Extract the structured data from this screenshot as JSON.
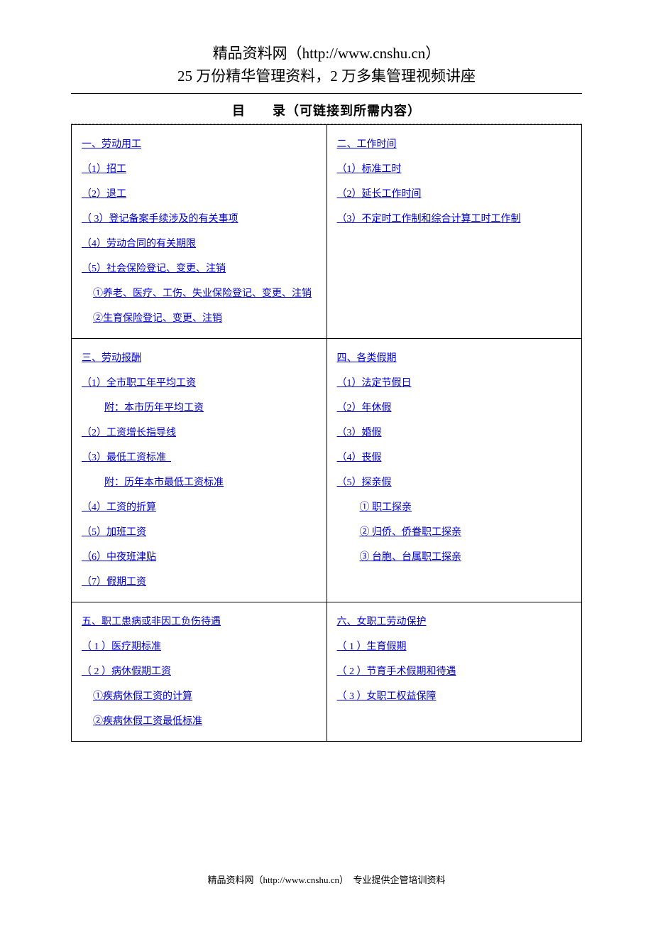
{
  "header": {
    "line1": "精品资料网（http://www.cnshu.cn）",
    "line2": "25 万份精华管理资料，2 万多集管理视频讲座"
  },
  "toc_title": "目　　录（可链接到所需内容）",
  "sections": {
    "s1": {
      "title": "一、劳动用工",
      "items": [
        {
          "text": "（1）招工",
          "indent": 0
        },
        {
          "text": "（2）退工",
          "indent": 0
        },
        {
          "text": "（ 3）登记备案手续涉及的有关事项",
          "indent": 0
        },
        {
          "text": "（4）劳动合同的有关期限",
          "indent": 0
        },
        {
          "text": "（5）社会保险登记、变更、注销",
          "indent": 0
        },
        {
          "text": "①养老、医疗、工伤、失业保险登记、变更、注销",
          "indent": 1
        },
        {
          "text": "②生育保险登记、变更、注销",
          "indent": 1
        }
      ]
    },
    "s2": {
      "title": "二、工作时间",
      "items": [
        {
          "text": "（1）标准工时",
          "indent": 0
        },
        {
          "text": "（2）延长工作时间",
          "indent": 0
        },
        {
          "text": "（3）不定时工作制和综合计算工时工作制",
          "indent": 0
        }
      ]
    },
    "s3": {
      "title": "三、劳动报酬",
      "items": [
        {
          "text": "（1）全市职工年平均工资",
          "indent": 0
        },
        {
          "text": "附：本市历年平均工资",
          "indent": 2
        },
        {
          "text": "（2）工资增长指导线",
          "indent": 0
        },
        {
          "text": "（3）最低工资标准  ",
          "indent": 0
        },
        {
          "text": "附：历年本市最低工资标准",
          "indent": 2
        },
        {
          "text": "（4）工资的折算",
          "indent": 0
        },
        {
          "text": "（5）加班工资",
          "indent": 0
        },
        {
          "text": "（6）中夜班津贴",
          "indent": 0
        },
        {
          "text": "（7）假期工资",
          "indent": 0
        }
      ]
    },
    "s4": {
      "title": "四、各类假期",
      "items": [
        {
          "text": "（1）法定节假日",
          "indent": 0
        },
        {
          "text": "（2）年休假",
          "indent": 0
        },
        {
          "text": "（3）婚假",
          "indent": 0
        },
        {
          "text": "（4）丧假",
          "indent": 0
        },
        {
          "text": "（5）探亲假",
          "indent": 0
        },
        {
          "text": "① 职工探亲",
          "indent": 2
        },
        {
          "text": "② 归侨、侨眷职工探亲",
          "indent": 2
        },
        {
          "text": "③ 台胞、台属职工探亲",
          "indent": 2
        }
      ]
    },
    "s5": {
      "title": "五、职工患病或非因工负伤待遇",
      "items": [
        {
          "text": "（ 1 ）医疗期标准",
          "indent": 0
        },
        {
          "text": "（ 2 ）病休假期工资",
          "indent": 0
        },
        {
          "text": "①疾病休假工资的计算",
          "indent": 1
        },
        {
          "text": "②疾病休假工资最低标准",
          "indent": 1
        }
      ]
    },
    "s6": {
      "title": "六、女职工劳动保护",
      "items": [
        {
          "text": "（ 1 ）生育假期",
          "indent": 0
        },
        {
          "text": "（ 2 ）节育手术假期和待遇",
          "indent": 0
        },
        {
          "text": "（ 3 ）女职工权益保障",
          "indent": 0
        }
      ]
    }
  },
  "footer": "精品资料网（http://www.cnshu.cn）  专业提供企管培训资料"
}
